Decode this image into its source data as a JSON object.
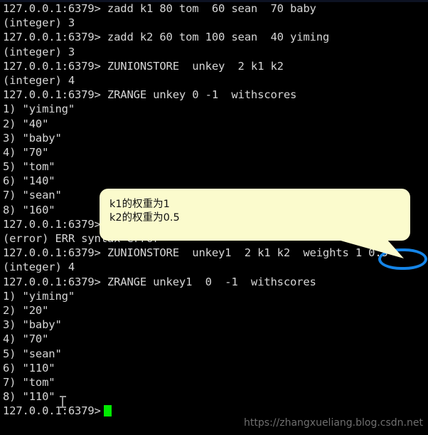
{
  "terminal": {
    "background_color": "#000000",
    "text_color": "#d6d6d6",
    "cursor_color": "#00ea00",
    "prompt": "127.0.0.1:6379>",
    "lines": [
      "127.0.0.1:6379> zadd k1 80 tom  60 sean  70 baby",
      "(integer) 3",
      "127.0.0.1:6379> zadd k2 60 tom 100 sean  40 yiming",
      "(integer) 3",
      "127.0.0.1:6379> ZUNIONSTORE  unkey  2 k1 k2",
      "(integer) 4",
      "127.0.0.1:6379> ZRANGE unkey 0 -1  withscores",
      "1) \"yiming\"",
      "2) \"40\"",
      "3) \"baby\"",
      "4) \"70\"",
      "5) \"tom\"",
      "6) \"140\"",
      "7) \"sean\"",
      "8) \"160\"",
      "127.0.0.1:6379>",
      "(error) ERR syntax error",
      "127.0.0.1:6379> ZUNIONSTORE  unkey1  2 k1 k2  weights 1 0.5",
      "(integer) 4",
      "127.0.0.1:6379> ZRANGE unkey1  0  -1  withscores",
      "1) \"yiming\"",
      "2) \"20\"",
      "3) \"baby\"",
      "4) \"70\"",
      "5) \"sean\"",
      "6) \"110\"",
      "7) \"tom\"",
      "8) \"110\"",
      "127.0.0.1:6379>"
    ],
    "final_prompt": "127.0.0.1:6379>"
  },
  "callout": {
    "text": "k1的权重为1\nk2的权重为0.5",
    "line1": "k1的权重为1",
    "line2": "k2的权重为0.5",
    "background_color": "#fbfbcd",
    "text_color": "#111111"
  },
  "highlight": {
    "target_text": "1 0.5",
    "color": "#1585e8",
    "shape": "ellipse-outline"
  },
  "watermark": {
    "text": "https://zhangxueliang.blog.csdn.net",
    "color": "#6f6f6f"
  }
}
